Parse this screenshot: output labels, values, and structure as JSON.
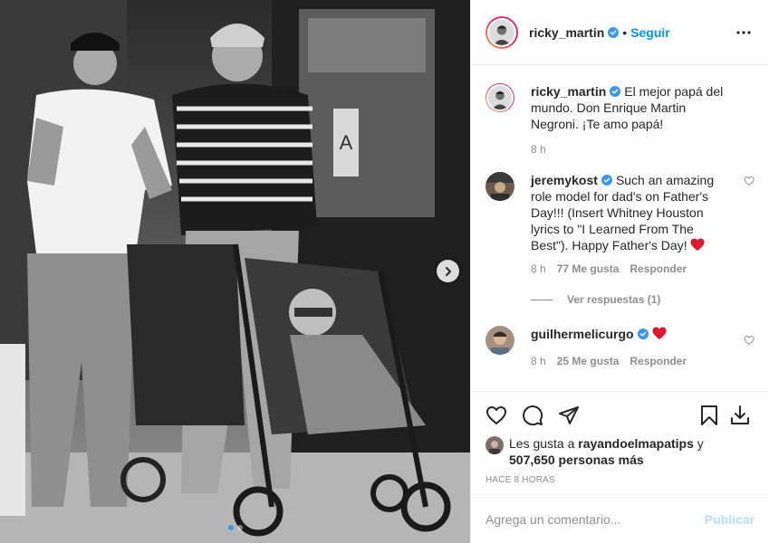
{
  "header": {
    "username": "ricky_martin",
    "separator": "•",
    "follow_label": "Seguir",
    "more_icon": "more-horizontal-icon",
    "verified_color": "#3897f0"
  },
  "caption": {
    "username": "ricky_martin",
    "text": "El mejor papá del mundo. Don Enrique Martin Negroni. ¡Te amo papá!",
    "time": "8 h"
  },
  "comments": [
    {
      "username": "jeremykost",
      "text": "Such an amazing role model for dad's on Father's Day!!! (Insert Whitney Houston lyrics to \"I Learned From The Best\"). Happy Father's Day!",
      "time": "8 h",
      "likes": "77 Me gusta",
      "reply": "Responder",
      "view_replies": "Ver respuestas (1)"
    },
    {
      "username": "guilhermelicurgo",
      "text": "",
      "time": "8 h",
      "likes": "25 Me gusta",
      "reply": "Responder"
    }
  ],
  "actions": {
    "icons": [
      "heart-icon",
      "comment-icon",
      "share-icon",
      "bookmark-icon",
      "download-icon"
    ]
  },
  "likes": {
    "prefix": "Les gusta a",
    "user": "rayandoelmapatips",
    "connector": "y",
    "count": "507,650 personas más"
  },
  "timestamp": "Hace 8 horas",
  "add_comment": {
    "placeholder": "Agrega un comentario...",
    "publish_label": "Publicar",
    "publish_color": "#b2dffc"
  },
  "carousel": {
    "slides": 2,
    "active": 0
  }
}
